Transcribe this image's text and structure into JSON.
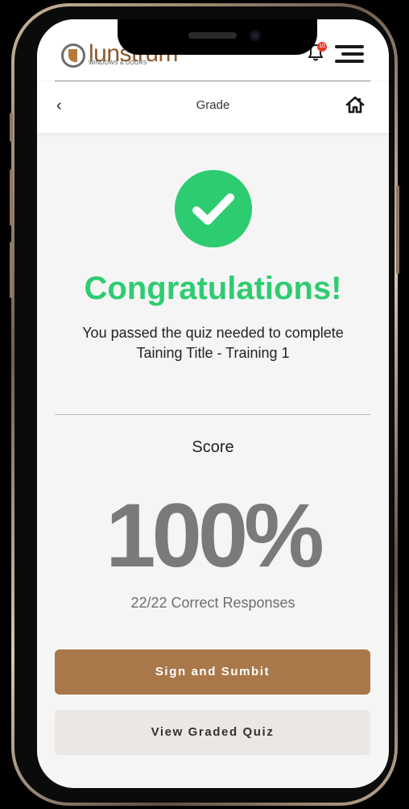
{
  "header": {
    "logo_text": "lunstrum",
    "logo_subtext": "WINDOWS & DOORS",
    "notification_count": "10",
    "page_title": "Grade"
  },
  "result": {
    "heading": "Congratulations!",
    "message": "You passed the quiz needed to complete Taining Title - Training 1",
    "score_label": "Score",
    "score_value": "100%",
    "correct_responses": "22/22 Correct Responses"
  },
  "actions": {
    "primary_label": "Sign and Sumbit",
    "secondary_label": "View Graded Quiz"
  },
  "colors": {
    "success": "#2ecc71",
    "brand": "#a9784a",
    "secondary_bg": "#ebe7e4"
  },
  "icons": [
    "logo-icon",
    "bell-icon",
    "hamburger-menu-icon",
    "back-chevron-icon",
    "home-icon",
    "checkmark-icon"
  ]
}
